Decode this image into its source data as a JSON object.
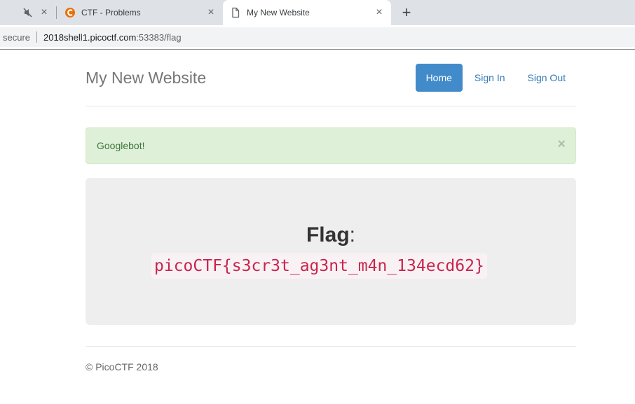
{
  "browser": {
    "tabs": [
      {
        "title": "",
        "icon": "muted-speaker-icon",
        "active": false
      },
      {
        "title": "CTF - Problems",
        "icon": "ctf-logo-icon",
        "active": false
      },
      {
        "title": "My New Website",
        "icon": "page-icon",
        "active": true
      }
    ],
    "new_tab_icon": "plus-icon",
    "address": {
      "security": "secure",
      "host": "2018shell1.picoctf.com",
      "path": ":53383/flag"
    }
  },
  "site": {
    "brand": "My New Website",
    "nav": [
      {
        "label": "Home",
        "active": true
      },
      {
        "label": "Sign In",
        "active": false
      },
      {
        "label": "Sign Out",
        "active": false
      }
    ],
    "alert": {
      "message": "Googlebot!",
      "close_glyph": "×"
    },
    "flag": {
      "label": "Flag",
      "separator": ":",
      "value": "picoCTF{s3cr3t_ag3nt_m4n_134ecd62}"
    },
    "footer": "© PicoCTF 2018"
  },
  "colors": {
    "accent": "#428bca",
    "link": "#337ab7",
    "alert_bg": "#dff0d8",
    "alert_text": "#3c763d",
    "code_text": "#c7254e"
  }
}
